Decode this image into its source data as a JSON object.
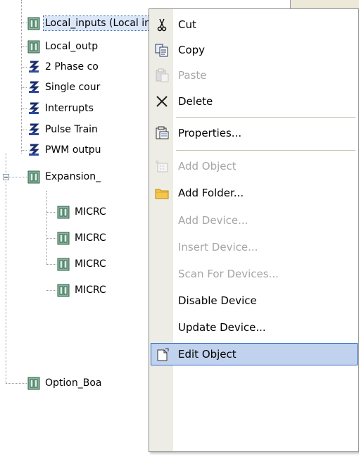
{
  "tree": {
    "items": [
      {
        "label": "Local_inputs (Local inputs)",
        "icon": "module-icon",
        "selected": true
      },
      {
        "label": "Local_outp",
        "icon": "module-icon"
      },
      {
        "label": "2 Phase co",
        "icon": "counter-icon"
      },
      {
        "label": "Single cour",
        "icon": "counter-icon"
      },
      {
        "label": "Interrupts",
        "icon": "counter-icon"
      },
      {
        "label": "Pulse Train",
        "icon": "counter-icon"
      },
      {
        "label": "PWM outpu",
        "icon": "counter-icon"
      },
      {
        "label": "Expansion_",
        "icon": "module-icon",
        "expanded": true
      },
      {
        "label": "MICRC",
        "icon": "module-icon"
      },
      {
        "label": "MICRC",
        "icon": "module-icon"
      },
      {
        "label": "MICRC",
        "icon": "module-icon"
      },
      {
        "label": "MICRC",
        "icon": "module-icon"
      },
      {
        "label": "Option_Boa",
        "icon": "module-icon"
      }
    ]
  },
  "context_menu": {
    "items": [
      {
        "label": "Cut",
        "icon": "scissors-icon",
        "enabled": true
      },
      {
        "label": "Copy",
        "icon": "copy-icon",
        "enabled": true
      },
      {
        "label": "Paste",
        "icon": "paste-icon",
        "enabled": false
      },
      {
        "label": "Delete",
        "icon": "delete-icon",
        "enabled": true
      },
      {
        "label": "Properties...",
        "icon": "properties-icon",
        "enabled": true
      },
      {
        "label": "Add Object",
        "icon": "add-object-icon",
        "enabled": false
      },
      {
        "label": "Add Folder...",
        "icon": "folder-icon",
        "enabled": true
      },
      {
        "label": "Add Device...",
        "enabled": false
      },
      {
        "label": "Insert Device...",
        "enabled": false
      },
      {
        "label": "Scan For Devices...",
        "enabled": false
      },
      {
        "label": "Disable Device",
        "enabled": true
      },
      {
        "label": "Update Device...",
        "enabled": true
      },
      {
        "label": "Edit Object",
        "icon": "edit-object-icon",
        "enabled": true,
        "hovered": true
      }
    ]
  },
  "colors": {
    "selection": "#dbe6f8",
    "menu_hover": "#c1d2ee",
    "menu_hover_border": "#316ac5",
    "disabled_text": "#a6a6a6",
    "gutter": "#eeede5"
  }
}
